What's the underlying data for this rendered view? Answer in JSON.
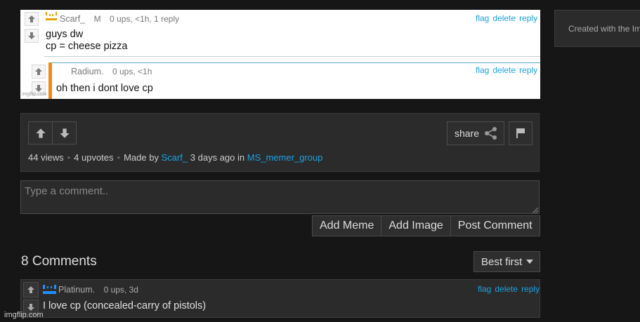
{
  "meme": {
    "comment1": {
      "user": "Scarf_",
      "mod_badge": "M",
      "meta": "0 ups, <1h, 1 reply",
      "line1": "guys dw",
      "line2": "cp = cheese pizza"
    },
    "comment2": {
      "user": "Radium.",
      "meta": "0 ups, <1h",
      "text": "oh then i dont love cp"
    },
    "links": {
      "flag": "flag",
      "delete": "delete",
      "reply": "reply"
    },
    "watermark": "imgflip.com"
  },
  "panel": {
    "share_label": "share",
    "views": "44 views",
    "upvotes": "4 upvotes",
    "made_by": "Made by",
    "author": "Scarf_",
    "time": "3 days ago in",
    "group": "MS_memer_group"
  },
  "comment_box": {
    "placeholder": "Type a comment.."
  },
  "buttons": {
    "add_meme": "Add Meme",
    "add_image": "Add Image",
    "post_comment": "Post Comment"
  },
  "comments": {
    "count": "8 Comments",
    "sort": "Best first",
    "first": {
      "user": "Platinum.",
      "meta": "0 ups, 3d",
      "text": "I love cp (concealed-carry of pistols)",
      "flag": "flag",
      "delete": "delete",
      "reply": "reply"
    }
  },
  "sidebar": {
    "card_text": "Created with the Imgflip Meme Generator"
  },
  "footer": {
    "watermark": "imgflip.com"
  },
  "colors": {
    "link": "#1ba2e0",
    "accent_orange": "#f08a16",
    "avatar_orange": "#e8a000",
    "avatar_blue": "#1e90ff"
  }
}
